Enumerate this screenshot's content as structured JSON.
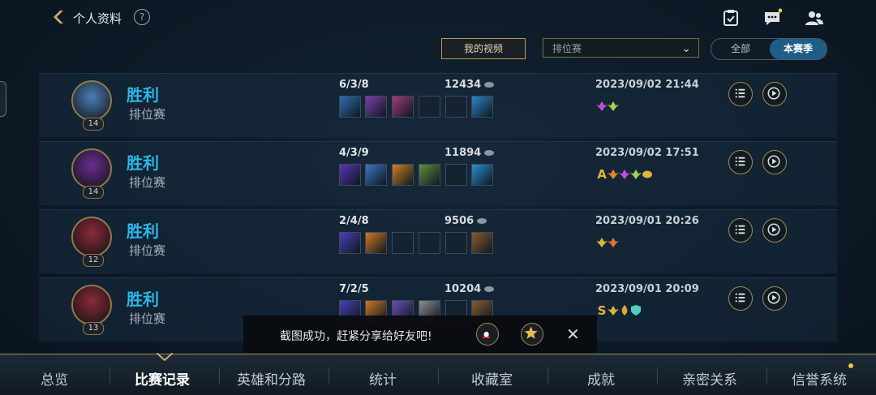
{
  "header": {
    "title": "个人资料",
    "help": "?",
    "icons": [
      "checklist-icon",
      "chat-icon",
      "friends-icon"
    ]
  },
  "filters": {
    "my_video": "我的视频",
    "queue_select": "排位赛",
    "season_toggle": {
      "all": "全部",
      "current": "本赛季",
      "selected": "current"
    }
  },
  "matches": [
    {
      "result": "胜利",
      "mode": "排位赛",
      "level": "14",
      "kda": "6/3/8",
      "gold": "12434",
      "datetime": "2023/09/02 21:44",
      "item_colors": [
        "#2f6fb0",
        "#7a3fa8",
        "#a33a7a",
        "",
        "",
        "#2c86c9"
      ],
      "badges": [
        {
          "t": "lotus",
          "c": "#b94fd6"
        },
        {
          "t": "figure",
          "c": "#9fd54a"
        }
      ],
      "avatar_color": "#4a7fb6"
    },
    {
      "result": "胜利",
      "mode": "排位赛",
      "level": "14",
      "kda": "4/3/9",
      "gold": "11894",
      "datetime": "2023/09/02 17:51",
      "item_colors": [
        "#5a34b8",
        "#3d76c4",
        "#d08024",
        "#5f8f3f",
        "",
        "#2a8fd0"
      ],
      "badges": [
        {
          "t": "A",
          "c": "#e0b53e"
        },
        {
          "t": "arc",
          "c": "#e08a2a"
        },
        {
          "t": "lotus",
          "c": "#b94fd6"
        },
        {
          "t": "figure",
          "c": "#9fd54a"
        },
        {
          "t": "oval",
          "c": "#e0b53e"
        }
      ],
      "avatar_color": "#6a2d91"
    },
    {
      "result": "胜利",
      "mode": "排位赛",
      "level": "12",
      "kda": "2/4/8",
      "gold": "9506",
      "datetime": "2023/09/01 20:26",
      "item_colors": [
        "#4b3fb8",
        "#cf7622",
        "",
        "",
        "",
        "#8a5a2f"
      ],
      "badges": [
        {
          "t": "leaf",
          "c": "#e0b53e"
        },
        {
          "t": "lotus",
          "c": "#e0703a"
        }
      ],
      "avatar_color": "#8a2a3a"
    },
    {
      "result": "胜利",
      "mode": "排位赛",
      "level": "13",
      "kda": "7/2/5",
      "gold": "10204",
      "datetime": "2023/09/01 20:09",
      "item_colors": [
        "#4b3fb8",
        "#cf7622",
        "#6a4fb0",
        "#8d8d8d",
        "",
        "#8a5a2f"
      ],
      "badges": [
        {
          "t": "S",
          "c": "#e0b53e"
        },
        {
          "t": "leaf",
          "c": "#e0b53e"
        },
        {
          "t": "flame",
          "c": "#e0a53a"
        },
        {
          "t": "shield",
          "c": "#4fd0c0"
        }
      ],
      "avatar_color": "#8a2a3a"
    }
  ],
  "toast": {
    "message": "截图成功，赶紧分享给好友吧!",
    "close": "✕"
  },
  "nav": {
    "tabs": [
      "总览",
      "比赛记录",
      "英雄和分路",
      "统计",
      "收藏室",
      "成就",
      "亲密关系",
      "信誉系统"
    ],
    "active_index": 1
  },
  "colors": {
    "accent_blue": "#2bb7e8",
    "gold_border": "#a38b57",
    "active_segment": "#1e5d86"
  }
}
